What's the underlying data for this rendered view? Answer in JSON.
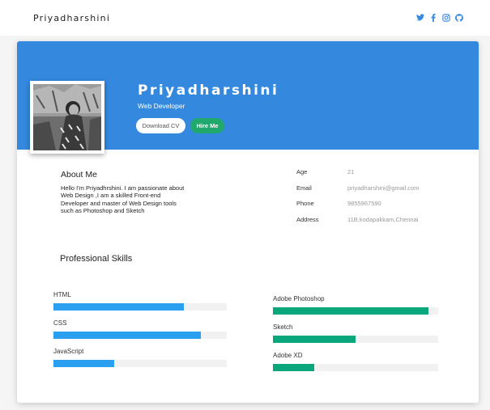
{
  "header": {
    "brand": "Priyadharshini",
    "social_icons": [
      "twitter-icon",
      "facebook-icon",
      "instagram-icon",
      "github-icon"
    ]
  },
  "colors": {
    "banner": "#3489df",
    "hire_button": "#21a86c",
    "skill_blue": "#2b9ff0",
    "skill_green": "#0aa67c"
  },
  "profile": {
    "name": "Priyadharshini",
    "role": "Web Developer",
    "download_cv_label": "Download CV",
    "hire_me_label": "Hire Me"
  },
  "about": {
    "title": "About Me",
    "text": "Hello I'm Priyadhrshini. I am passionate about Web Design ,I am a skilled Front-end Developer and master of Web Design tools such as Photoshop and Sketch"
  },
  "info": [
    {
      "label": "Age",
      "value": "21"
    },
    {
      "label": "Email",
      "value": "priyadharshini@gmail.com"
    },
    {
      "label": "Phone",
      "value": "9855967590"
    },
    {
      "label": "Address",
      "value": "11B,kodapakkam,Chennai"
    }
  ],
  "skills": {
    "title": "Professional Skills",
    "left": [
      {
        "name": "HTML",
        "level": 0.75
      },
      {
        "name": "CSS",
        "level": 0.85
      },
      {
        "name": "JavaScript",
        "level": 0.35
      }
    ],
    "right": [
      {
        "name": "Adobe Photoshop",
        "level": 0.94
      },
      {
        "name": "Sketch",
        "level": 0.5
      },
      {
        "name": "Adobe XD",
        "level": 0.25
      }
    ]
  }
}
